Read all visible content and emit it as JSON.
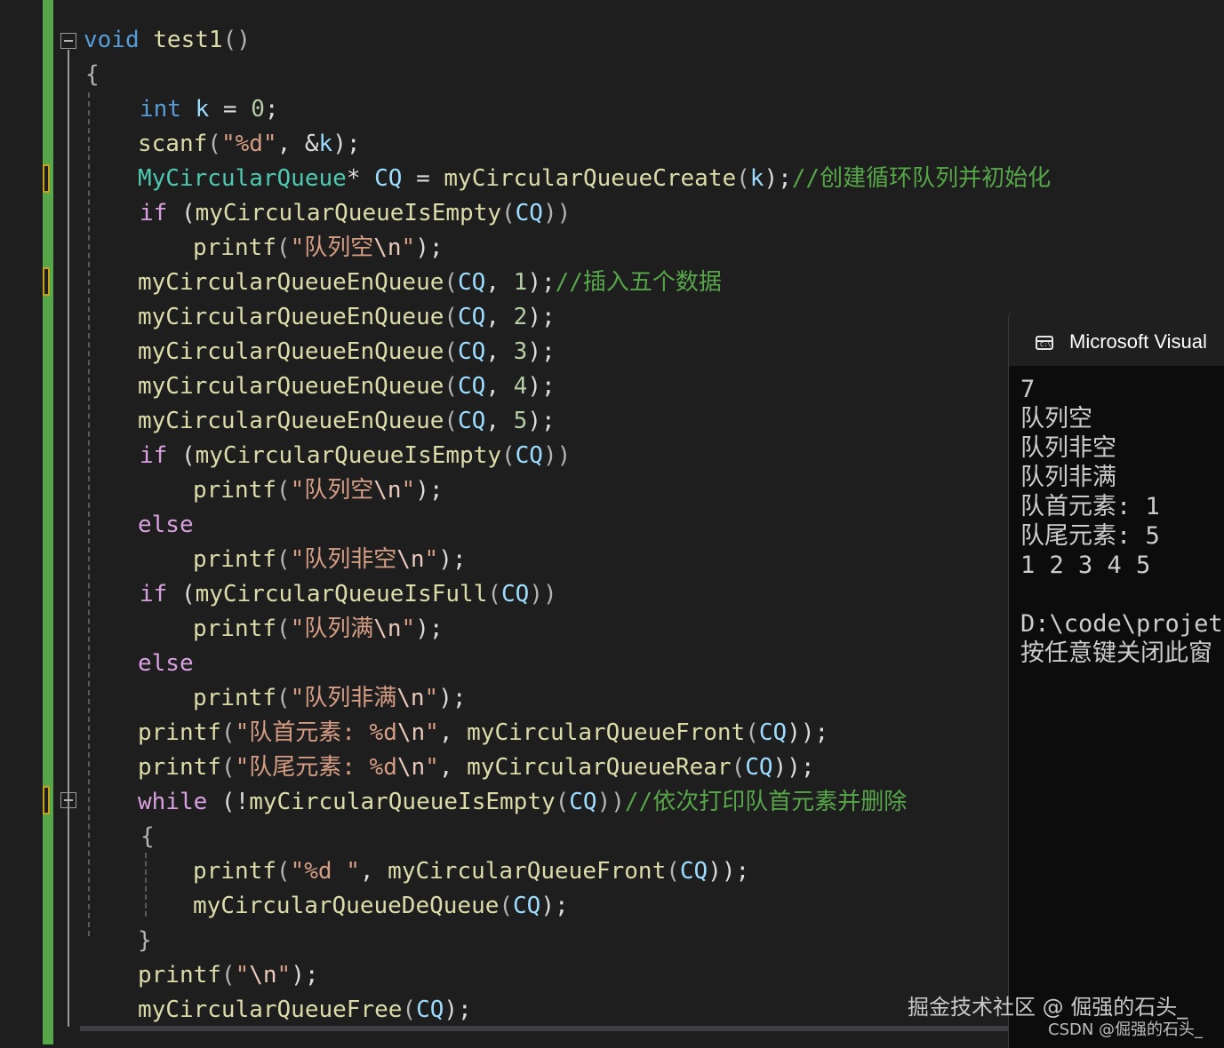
{
  "editor": {
    "lines": [
      {
        "tokens": [
          {
            "t": "void",
            "c": "kw"
          },
          {
            "t": " ",
            "c": ""
          },
          {
            "t": "test1",
            "c": "fn"
          },
          {
            "t": "()",
            "c": "pn"
          }
        ]
      },
      {
        "tokens": [
          {
            "t": "{",
            "c": "pn"
          }
        ]
      },
      {
        "tokens": [
          {
            "t": "int",
            "c": "kw"
          },
          {
            "t": " ",
            "c": ""
          },
          {
            "t": "k",
            "c": "vr"
          },
          {
            "t": " = ",
            "c": ""
          },
          {
            "t": "0",
            "c": "nm"
          },
          {
            "t": ";",
            "c": ""
          }
        ]
      },
      {
        "tokens": [
          {
            "t": "scanf",
            "c": "fn"
          },
          {
            "t": "(",
            "c": "pn"
          },
          {
            "t": "\"%d\"",
            "c": "st"
          },
          {
            "t": ", &",
            "c": ""
          },
          {
            "t": "k",
            "c": "vr"
          },
          {
            "t": ");",
            "c": ""
          }
        ]
      },
      {
        "tokens": [
          {
            "t": "MyCircularQueue",
            "c": "ty"
          },
          {
            "t": "* ",
            "c": ""
          },
          {
            "t": "CQ",
            "c": "vr"
          },
          {
            "t": " = ",
            "c": ""
          },
          {
            "t": "myCircularQueueCreate",
            "c": "fn"
          },
          {
            "t": "(",
            "c": "pn"
          },
          {
            "t": "k",
            "c": "vr"
          },
          {
            "t": ");",
            "c": ""
          },
          {
            "t": "//创建循环队列并初始化",
            "c": "cm"
          }
        ]
      },
      {
        "tokens": [
          {
            "t": "if",
            "c": "cf"
          },
          {
            "t": " (",
            "c": ""
          },
          {
            "t": "myCircularQueueIsEmpty",
            "c": "fn"
          },
          {
            "t": "(",
            "c": "pn"
          },
          {
            "t": "CQ",
            "c": "vr"
          },
          {
            "t": "))",
            "c": "pn"
          }
        ]
      },
      {
        "tokens": [
          {
            "t": "printf",
            "c": "fn"
          },
          {
            "t": "(",
            "c": "pn"
          },
          {
            "t": "\"队列空",
            "c": "st"
          },
          {
            "t": "\\n",
            "c": "es"
          },
          {
            "t": "\"",
            "c": "st"
          },
          {
            "t": ");",
            "c": ""
          }
        ]
      },
      {
        "tokens": [
          {
            "t": "myCircularQueueEnQueue",
            "c": "fn"
          },
          {
            "t": "(",
            "c": "pn"
          },
          {
            "t": "CQ",
            "c": "vr"
          },
          {
            "t": ", ",
            "c": ""
          },
          {
            "t": "1",
            "c": "nm"
          },
          {
            "t": ");",
            "c": ""
          },
          {
            "t": "//插入五个数据",
            "c": "cm"
          }
        ]
      },
      {
        "tokens": [
          {
            "t": "myCircularQueueEnQueue",
            "c": "fn"
          },
          {
            "t": "(",
            "c": "pn"
          },
          {
            "t": "CQ",
            "c": "vr"
          },
          {
            "t": ", ",
            "c": ""
          },
          {
            "t": "2",
            "c": "nm"
          },
          {
            "t": ");",
            "c": ""
          }
        ]
      },
      {
        "tokens": [
          {
            "t": "myCircularQueueEnQueue",
            "c": "fn"
          },
          {
            "t": "(",
            "c": "pn"
          },
          {
            "t": "CQ",
            "c": "vr"
          },
          {
            "t": ", ",
            "c": ""
          },
          {
            "t": "3",
            "c": "nm"
          },
          {
            "t": ");",
            "c": ""
          }
        ]
      },
      {
        "tokens": [
          {
            "t": "myCircularQueueEnQueue",
            "c": "fn"
          },
          {
            "t": "(",
            "c": "pn"
          },
          {
            "t": "CQ",
            "c": "vr"
          },
          {
            "t": ", ",
            "c": ""
          },
          {
            "t": "4",
            "c": "nm"
          },
          {
            "t": ");",
            "c": ""
          }
        ]
      },
      {
        "tokens": [
          {
            "t": "myCircularQueueEnQueue",
            "c": "fn"
          },
          {
            "t": "(",
            "c": "pn"
          },
          {
            "t": "CQ",
            "c": "vr"
          },
          {
            "t": ", ",
            "c": ""
          },
          {
            "t": "5",
            "c": "nm"
          },
          {
            "t": ");",
            "c": ""
          }
        ]
      },
      {
        "tokens": [
          {
            "t": "if",
            "c": "cf"
          },
          {
            "t": " (",
            "c": ""
          },
          {
            "t": "myCircularQueueIsEmpty",
            "c": "fn"
          },
          {
            "t": "(",
            "c": "pn"
          },
          {
            "t": "CQ",
            "c": "vr"
          },
          {
            "t": "))",
            "c": "pn"
          }
        ]
      },
      {
        "tokens": [
          {
            "t": "printf",
            "c": "fn"
          },
          {
            "t": "(",
            "c": "pn"
          },
          {
            "t": "\"队列空",
            "c": "st"
          },
          {
            "t": "\\n",
            "c": "es"
          },
          {
            "t": "\"",
            "c": "st"
          },
          {
            "t": ");",
            "c": ""
          }
        ]
      },
      {
        "tokens": [
          {
            "t": "else",
            "c": "cf"
          }
        ]
      },
      {
        "tokens": [
          {
            "t": "printf",
            "c": "fn"
          },
          {
            "t": "(",
            "c": "pn"
          },
          {
            "t": "\"队列非空",
            "c": "st"
          },
          {
            "t": "\\n",
            "c": "es"
          },
          {
            "t": "\"",
            "c": "st"
          },
          {
            "t": ");",
            "c": ""
          }
        ]
      },
      {
        "tokens": [
          {
            "t": "if",
            "c": "cf"
          },
          {
            "t": " (",
            "c": ""
          },
          {
            "t": "myCircularQueueIsFull",
            "c": "fn"
          },
          {
            "t": "(",
            "c": "pn"
          },
          {
            "t": "CQ",
            "c": "vr"
          },
          {
            "t": "))",
            "c": "pn"
          }
        ]
      },
      {
        "tokens": [
          {
            "t": "printf",
            "c": "fn"
          },
          {
            "t": "(",
            "c": "pn"
          },
          {
            "t": "\"队列满",
            "c": "st"
          },
          {
            "t": "\\n",
            "c": "es"
          },
          {
            "t": "\"",
            "c": "st"
          },
          {
            "t": ");",
            "c": ""
          }
        ]
      },
      {
        "tokens": [
          {
            "t": "else",
            "c": "cf"
          }
        ]
      },
      {
        "tokens": [
          {
            "t": "printf",
            "c": "fn"
          },
          {
            "t": "(",
            "c": "pn"
          },
          {
            "t": "\"队列非满",
            "c": "st"
          },
          {
            "t": "\\n",
            "c": "es"
          },
          {
            "t": "\"",
            "c": "st"
          },
          {
            "t": ");",
            "c": ""
          }
        ]
      },
      {
        "tokens": [
          {
            "t": "printf",
            "c": "fn"
          },
          {
            "t": "(",
            "c": "pn"
          },
          {
            "t": "\"队首元素: %d",
            "c": "st"
          },
          {
            "t": "\\n",
            "c": "es"
          },
          {
            "t": "\"",
            "c": "st"
          },
          {
            "t": ", ",
            "c": ""
          },
          {
            "t": "myCircularQueueFront",
            "c": "fn"
          },
          {
            "t": "(",
            "c": "pn"
          },
          {
            "t": "CQ",
            "c": "vr"
          },
          {
            "t": "));",
            "c": ""
          }
        ]
      },
      {
        "tokens": [
          {
            "t": "printf",
            "c": "fn"
          },
          {
            "t": "(",
            "c": "pn"
          },
          {
            "t": "\"队尾元素: %d",
            "c": "st"
          },
          {
            "t": "\\n",
            "c": "es"
          },
          {
            "t": "\"",
            "c": "st"
          },
          {
            "t": ", ",
            "c": ""
          },
          {
            "t": "myCircularQueueRear",
            "c": "fn"
          },
          {
            "t": "(",
            "c": "pn"
          },
          {
            "t": "CQ",
            "c": "vr"
          },
          {
            "t": "));",
            "c": ""
          }
        ]
      },
      {
        "tokens": [
          {
            "t": "while",
            "c": "cf"
          },
          {
            "t": " (!",
            "c": ""
          },
          {
            "t": "myCircularQueueIsEmpty",
            "c": "fn"
          },
          {
            "t": "(",
            "c": "pn"
          },
          {
            "t": "CQ",
            "c": "vr"
          },
          {
            "t": "))",
            "c": "pn"
          },
          {
            "t": "//依次打印队首元素并删除",
            "c": "cm"
          }
        ]
      },
      {
        "tokens": [
          {
            "t": "{",
            "c": "pn"
          }
        ]
      },
      {
        "tokens": [
          {
            "t": "printf",
            "c": "fn"
          },
          {
            "t": "(",
            "c": "pn"
          },
          {
            "t": "\"%d \"",
            "c": "st"
          },
          {
            "t": ", ",
            "c": ""
          },
          {
            "t": "myCircularQueueFront",
            "c": "fn"
          },
          {
            "t": "(",
            "c": "pn"
          },
          {
            "t": "CQ",
            "c": "vr"
          },
          {
            "t": "));",
            "c": ""
          }
        ]
      },
      {
        "tokens": [
          {
            "t": "myCircularQueueDeQueue",
            "c": "fn"
          },
          {
            "t": "(",
            "c": "pn"
          },
          {
            "t": "CQ",
            "c": "vr"
          },
          {
            "t": ");",
            "c": ""
          }
        ]
      },
      {
        "tokens": [
          {
            "t": "}",
            "c": "pn"
          }
        ]
      },
      {
        "tokens": [
          {
            "t": "printf",
            "c": "fn"
          },
          {
            "t": "(",
            "c": "pn"
          },
          {
            "t": "\"",
            "c": "st"
          },
          {
            "t": "\\n",
            "c": "es"
          },
          {
            "t": "\"",
            "c": "st"
          },
          {
            "t": ");",
            "c": ""
          }
        ]
      },
      {
        "tokens": [
          {
            "t": "myCircularQueueFree",
            "c": "fn"
          },
          {
            "t": "(",
            "c": "pn"
          },
          {
            "t": "CQ",
            "c": "vr"
          },
          {
            "t": ");",
            "c": ""
          }
        ]
      }
    ]
  },
  "console": {
    "title": "Microsoft Visual",
    "lines": [
      "7",
      "队列空",
      "队列非空",
      "队列非满",
      "队首元素: 1",
      "队尾元素: 5",
      "1 2 3 4 5",
      "",
      "D:\\code\\projete",
      "按任意键关闭此窗"
    ],
    "icon": "console-window-icon"
  },
  "watermark": {
    "main": "掘金技术社区 @ 倔强的石头_",
    "sub": "CSDN @倔强的石头_"
  },
  "colors": {
    "background": "#1e1e1e",
    "keyword": "#569cd6",
    "control": "#d8a0df",
    "type": "#4ec9b0",
    "function": "#dcdcaa",
    "variable": "#9cdcfe",
    "string": "#d69d85",
    "comment": "#57a64a",
    "number": "#b5cea8",
    "changed_bar": "#57a64a",
    "unsaved_mark": "#c8a020"
  }
}
